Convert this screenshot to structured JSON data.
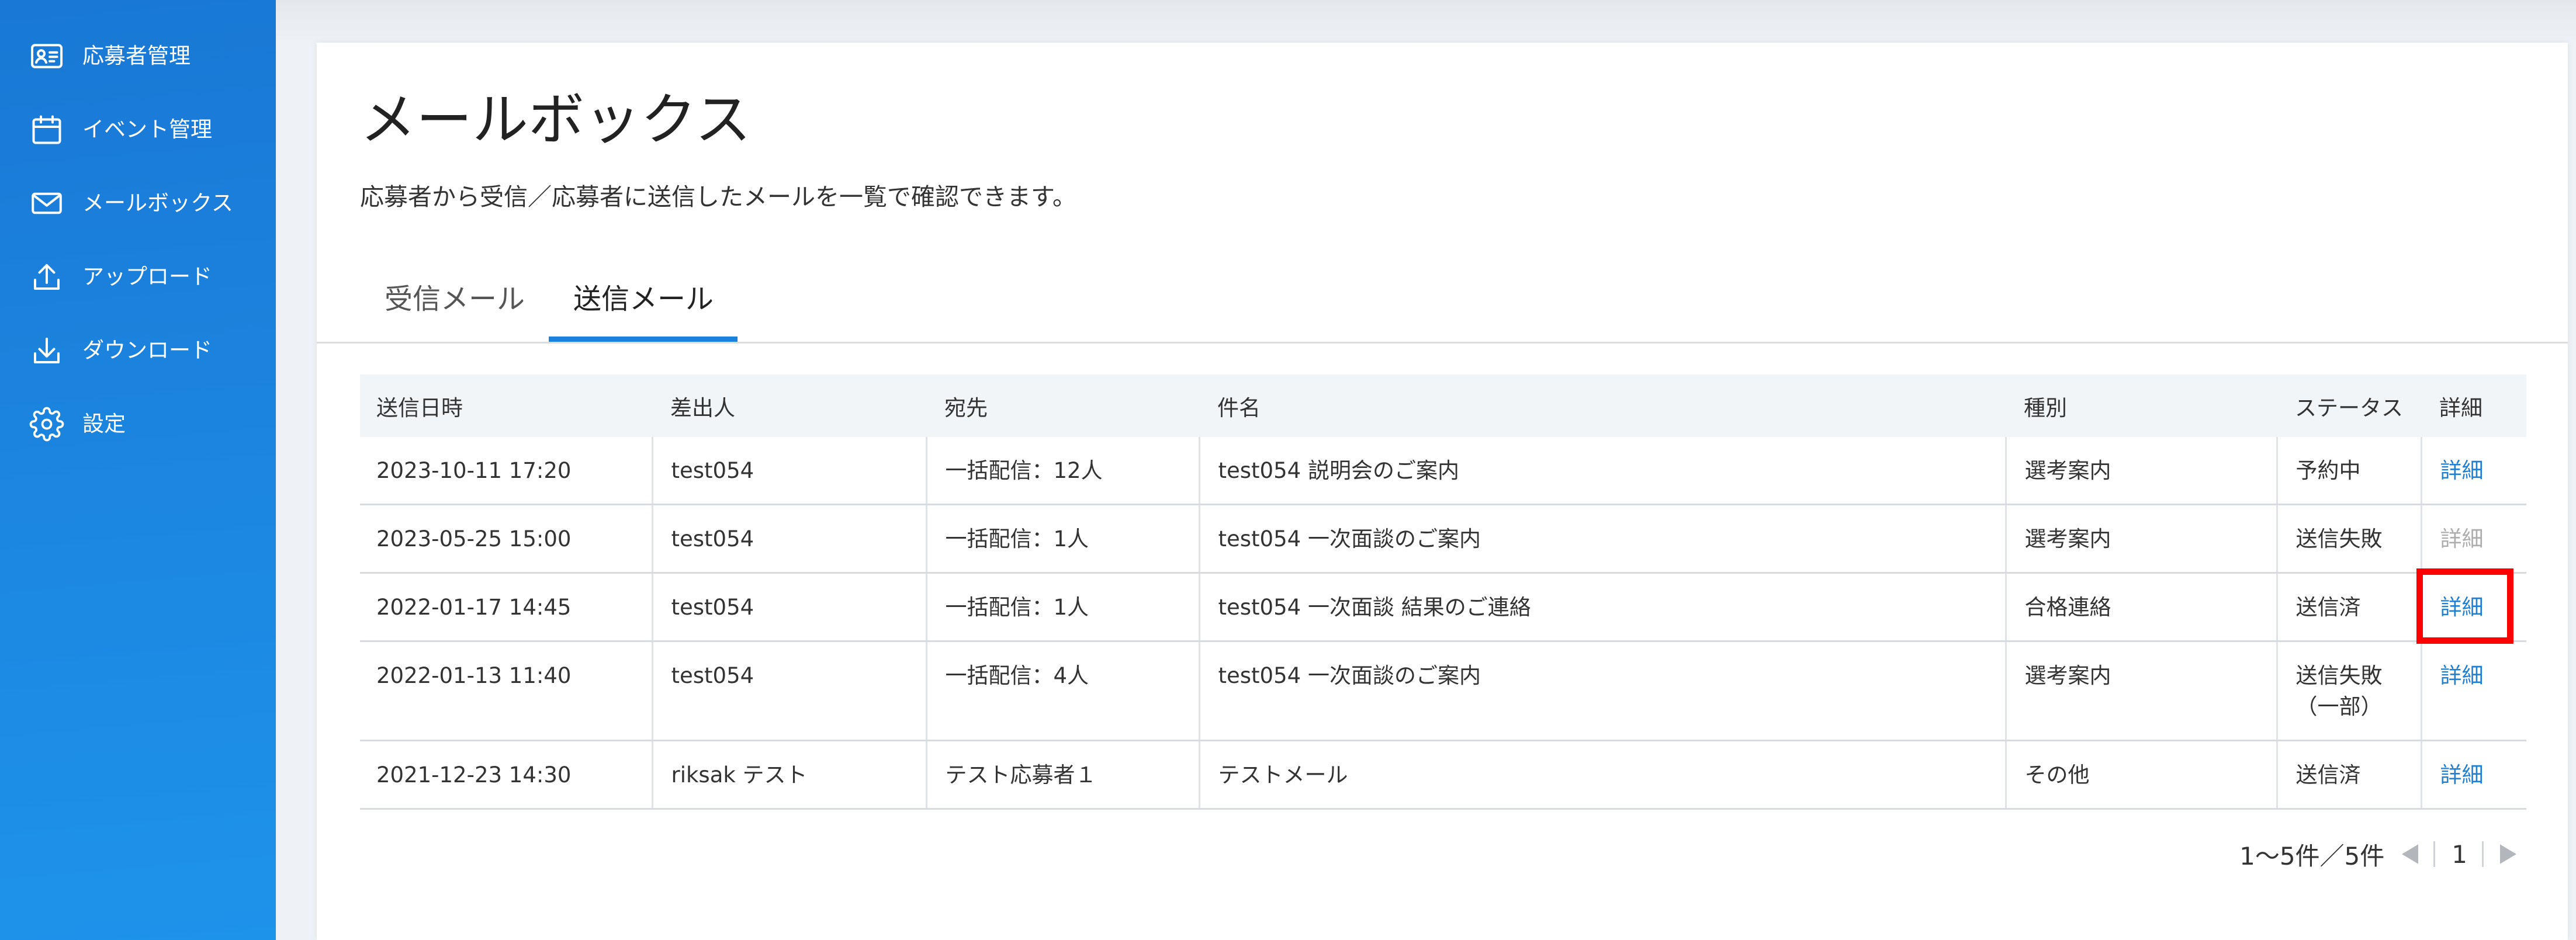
{
  "colors": {
    "sidebar_top": "#1978d5",
    "sidebar_bottom": "#1e93ea",
    "accent": "#1a82dc",
    "link": "#1f7fd1",
    "link_disabled": "#adadad",
    "highlight": "#ff0000"
  },
  "sidebar": {
    "items": [
      {
        "label": "応募者管理",
        "icon": "id-card-icon"
      },
      {
        "label": "イベント管理",
        "icon": "calendar-icon"
      },
      {
        "label": "メールボックス",
        "icon": "mail-icon"
      },
      {
        "label": "アップロード",
        "icon": "upload-icon"
      },
      {
        "label": "ダウンロード",
        "icon": "download-icon"
      },
      {
        "label": "設定",
        "icon": "gear-icon"
      }
    ]
  },
  "page": {
    "title": "メールボックス",
    "description": "応募者から受信／応募者に送信したメールを一覧で確認できます。"
  },
  "tabs": [
    {
      "label": "受信メール",
      "active": false
    },
    {
      "label": "送信メール",
      "active": true
    }
  ],
  "table": {
    "columns": [
      "送信日時",
      "差出人",
      "宛先",
      "件名",
      "種別",
      "ステータス",
      "詳細"
    ],
    "rows": [
      {
        "sent_at": "2023-10-11 17:20",
        "sender": "test054",
        "recipient": "一括配信：12人",
        "subject": "test054 説明会のご案内",
        "type": "選考案内",
        "status": "予約中",
        "detail": "詳細",
        "detail_enabled": true
      },
      {
        "sent_at": "2023-05-25 15:00",
        "sender": "test054",
        "recipient": "一括配信：1人",
        "subject": "test054 一次面談のご案内",
        "type": "選考案内",
        "status": "送信失敗",
        "detail": "詳細",
        "detail_enabled": false
      },
      {
        "sent_at": "2022-01-17 14:45",
        "sender": "test054",
        "recipient": "一括配信：1人",
        "subject": "test054 一次面談 結果のご連絡",
        "type": "合格連絡",
        "status": "送信済",
        "detail": "詳細",
        "detail_enabled": true
      },
      {
        "sent_at": "2022-01-13 11:40",
        "sender": "test054",
        "recipient": "一括配信：4人",
        "subject": "test054 一次面談のご案内",
        "type": "選考案内",
        "status": "送信失敗\n（一部）",
        "detail": "詳細",
        "detail_enabled": true
      },
      {
        "sent_at": "2021-12-23 14:30",
        "sender": "riksak テスト",
        "recipient": "テスト応募者１",
        "subject": "テストメール",
        "type": "その他",
        "status": "送信済",
        "detail": "詳細",
        "detail_enabled": true
      }
    ]
  },
  "pagination": {
    "summary": "1～5件／5件",
    "current_page": "1",
    "prev_icon": "caret-left-icon",
    "next_icon": "caret-right-icon"
  }
}
